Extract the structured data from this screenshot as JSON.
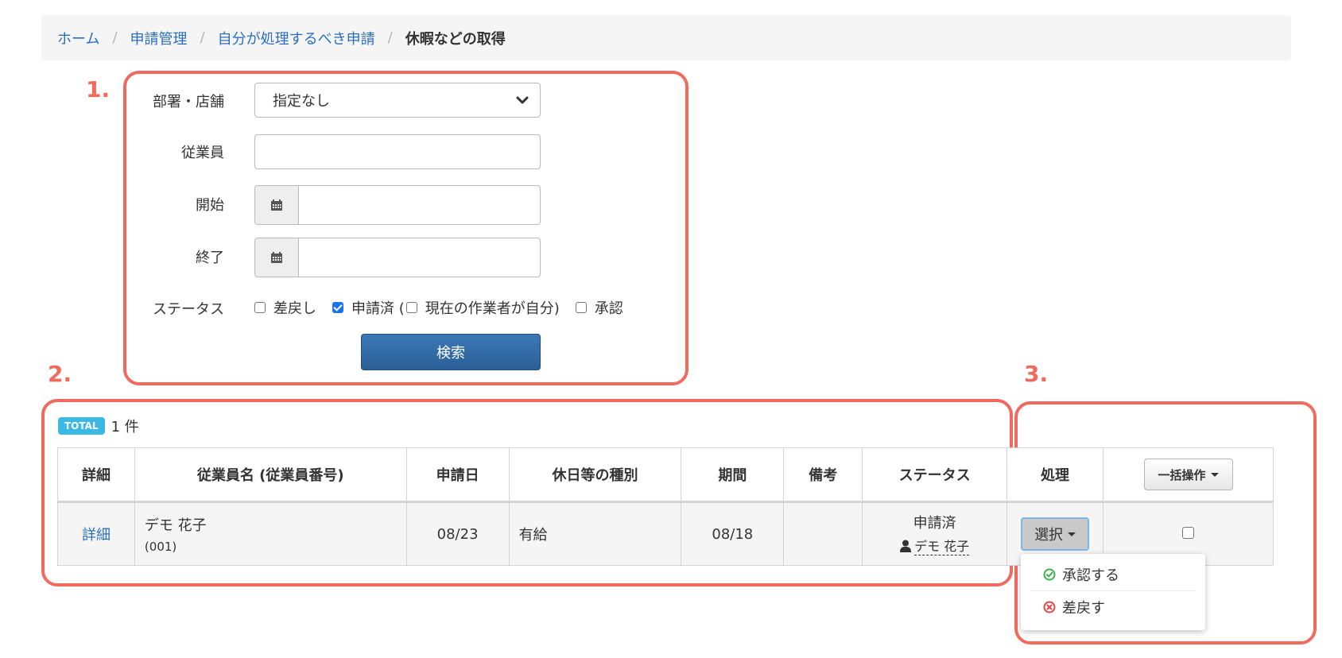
{
  "breadcrumb": {
    "home": "ホーム",
    "requests": "申請管理",
    "my_requests": "自分が処理するべき申請",
    "current": "休暇などの取得",
    "separator": "/"
  },
  "annotations": {
    "label1": "1.",
    "label2": "2.",
    "label3": "3."
  },
  "search": {
    "department_label": "部署・店舗",
    "department_value": "指定なし",
    "employee_label": "従業員",
    "employee_value": "",
    "start_label": "開始",
    "start_value": "",
    "end_label": "終了",
    "end_value": "",
    "status_label": "ステータス",
    "status_options": [
      {
        "label": "差戻し",
        "checked": false
      },
      {
        "label": "申請済 (",
        "checked": true
      },
      {
        "label": "現在の作業者が自分)",
        "checked": false
      },
      {
        "label": "承認",
        "checked": false
      }
    ],
    "search_button": "検索"
  },
  "total": {
    "badge": "TOTAL",
    "count": "1 件"
  },
  "table": {
    "headers": {
      "detail": "詳細",
      "employee": "従業員名 (従業員番号)",
      "applied": "申請日",
      "leave_type": "休日等の種別",
      "period": "期間",
      "remarks": "備考",
      "status": "ステータス",
      "action": "処理",
      "bulk": "一括操作"
    },
    "rows": [
      {
        "detail_link": "詳細",
        "employee_name": "デモ 花子",
        "employee_no": "(001)",
        "applied": "08/23",
        "leave_type": "有給",
        "period": "08/18",
        "remarks": "",
        "status": "申請済",
        "worker": "デモ 花子",
        "select_label": "選択"
      }
    ]
  },
  "dropdown": {
    "approve": "承認する",
    "return": "差戻す",
    "approve_color": "#3cae4f",
    "return_color": "#e04848"
  },
  "colors": {
    "annotation": "#f06a5e",
    "link": "#2a6fbf",
    "primary_button": "#2b5f96",
    "badge": "#3cb8e6"
  }
}
